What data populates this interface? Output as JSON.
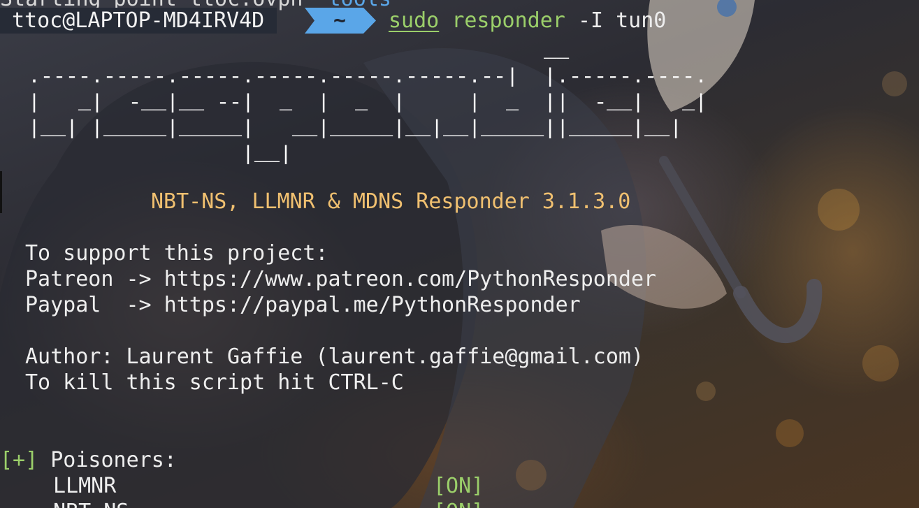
{
  "terminal": {
    "previous_line": {
      "text": "Starting_point_ttoc.ovpn",
      "dir_text": "tools"
    },
    "prompt": {
      "user_host": "ttoc@LAPTOP-MD4IRV4D",
      "directory": "~",
      "command_sudo": "sudo",
      "command_bin": "responder",
      "command_args": "-I tun0"
    },
    "banner_ascii": "                                         __\n.----.-----.-----.-----.-----.-----.--|  |.-----.----.\n|   _|  -__|__ --|  _  |  _  |     |  _  ||  -__|   _|\n|__| |_____|_____|   __|_____|__|__|_____||_____|__|\n                 |__|",
    "version_line": "NBT-NS, LLMNR & MDNS Responder 3.1.3.0",
    "support_heading": "To support this project:",
    "patreon_line": "Patreon -> https://www.patreon.com/PythonResponder",
    "paypal_line": "Paypal  -> https://paypal.me/PythonResponder",
    "author_line": "Author: Laurent Gaffie (laurent.gaffie@gmail.com)",
    "kill_line": "To kill this script hit CTRL-C",
    "poisoners": {
      "marker": "[+]",
      "heading": "Poisoners:",
      "items": [
        {
          "name": "LLMNR",
          "status": "[ON]"
        },
        {
          "name": "NBT-NS",
          "status": "[ON]"
        }
      ]
    }
  },
  "colors": {
    "prompt_user_bg": "#262b36",
    "prompt_dir_bg": "#5aa6e8",
    "command_green": "#9bcf6a",
    "version_gold": "#f0c070",
    "text": "#eeeeee"
  }
}
